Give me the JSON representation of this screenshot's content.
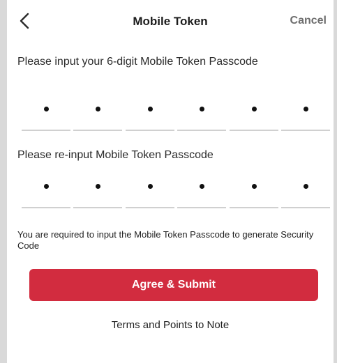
{
  "header": {
    "back_icon": "chevron-left-icon",
    "title": "Mobile Token",
    "cancel_label": "Cancel"
  },
  "passcode": {
    "prompt": "Please input your 6-digit Mobile Token Passcode",
    "digits_entered": 6
  },
  "confirm": {
    "prompt": "Please re-input Mobile Token Passcode",
    "digits_entered": 6
  },
  "note": "You are required to input the Mobile Token Passcode to generate Security Code",
  "submit_label": "Agree & Submit",
  "terms_label": "Terms and Points to Note",
  "colors": {
    "accent": "#d22c3f",
    "background": "#d9d9d9",
    "screen": "#ffffff"
  }
}
